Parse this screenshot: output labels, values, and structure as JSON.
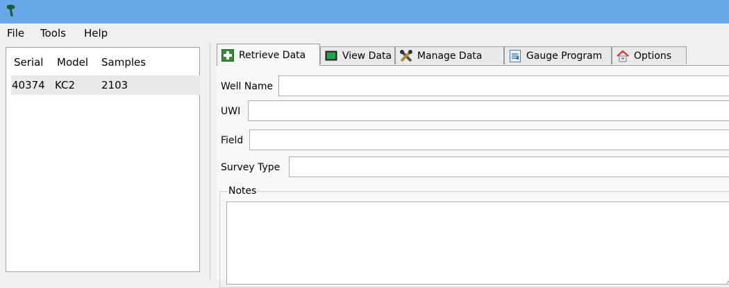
{
  "menu": {
    "file": "File",
    "tools": "Tools",
    "help": "Help"
  },
  "device_list": {
    "columns": [
      "Serial",
      "Model",
      "Samples"
    ],
    "rows": [
      {
        "serial": "40374",
        "model": "KC2",
        "samples": "2103"
      }
    ]
  },
  "tabs": [
    {
      "label": "Retrieve Data",
      "icon": "plus-icon",
      "active": true
    },
    {
      "label": "View Data",
      "icon": "monitor-icon"
    },
    {
      "label": "Manage Data",
      "icon": "tools-icon"
    },
    {
      "label": "Gauge Program",
      "icon": "program-icon"
    },
    {
      "label": "Options",
      "icon": "home-icon"
    }
  ],
  "form": {
    "well_name_label": "Well Name",
    "well_name_value": "",
    "uwi_label": "UWI",
    "uwi_value": "",
    "field_label": "Field",
    "field_value": "",
    "survey_type_label": "Survey Type",
    "survey_type_value": "",
    "notes_label": "Notes",
    "notes_value": ""
  },
  "colors": {
    "titlebar": "#6aa7e8",
    "selected_row": "#e9e9e9",
    "window_bg": "#f0f0f0"
  }
}
